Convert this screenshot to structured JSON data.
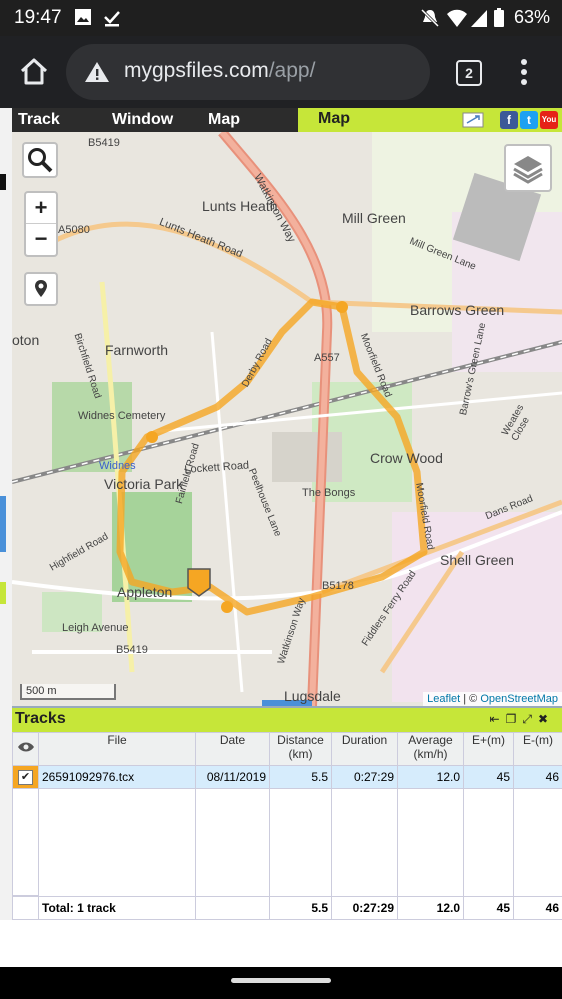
{
  "status": {
    "time": "19:47",
    "battery": "63%"
  },
  "browser": {
    "url_host": "mygpsfiles.com",
    "url_path": "/app/",
    "tab_count": "2"
  },
  "menu": {
    "track": "Track",
    "window": "Window",
    "map": "Map",
    "map_panel_title": "Map"
  },
  "social": {
    "facebook": "f",
    "twitter": "t",
    "youtube": "You"
  },
  "map": {
    "zoom_in": "+",
    "zoom_out": "−",
    "scale": "500 m",
    "attribution_leaflet": "Leaflet",
    "attribution_sep": " | © ",
    "attribution_osm": "OpenStreetMap",
    "places": [
      "B5419",
      "Lunts Heath",
      "Watkinson Way",
      "Mill Green",
      "A5080",
      "Lunts Heath Road",
      "Mill Green Lane",
      "Barrows Green",
      "oton",
      "Birchfield Road",
      "Farnworth",
      "A557",
      "Moorfield Road",
      "Derby Road",
      "Widnes Cemetery",
      "Crow Wood",
      "Widnes",
      "Lockett Road",
      "Victoria Park",
      "Peelhouse Lane",
      "The Bongs",
      "Weates Close",
      "Barrow's Green Lane",
      "Dans Road",
      "Moorfield Road",
      "Fairfield Road",
      "Highfield Road",
      "Shell Green",
      "Appleton",
      "B5178",
      "Fiddlers Ferry Road",
      "Leigh Avenue",
      "Watkinson Way",
      "B5419",
      "Lugsdale"
    ]
  },
  "tracks": {
    "title": "Tracks",
    "columns": [
      "File",
      "Date",
      "Distance (km)",
      "Duration",
      "Average (km/h)",
      "E+(m)",
      "E-(m)"
    ],
    "rows": [
      {
        "file": "26591092976.tcx",
        "date": "08/11/2019",
        "distance": "5.5",
        "duration": "0:27:29",
        "average": "12.0",
        "eplus": "45",
        "eminus": "46"
      }
    ],
    "total": {
      "label": "Total: 1 track",
      "distance": "5.5",
      "duration": "0:27:29",
      "average": "12.0",
      "eplus": "45",
      "eminus": "46"
    }
  },
  "colors": {
    "accent": "#c6e639",
    "track": "#f5a623",
    "selected_row": "#d6ecfc"
  }
}
